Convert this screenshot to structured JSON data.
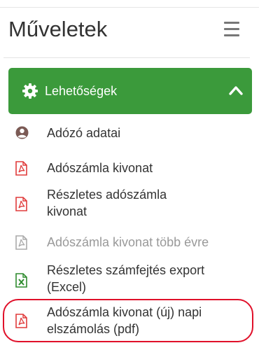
{
  "header": {
    "title": "Műveletek",
    "menu_icon": "hamburger-icon"
  },
  "panel": {
    "label": "Lehetőségek",
    "icon": "gear-icon",
    "toggle_icon": "chevron-up-icon",
    "color": "#3b9a3b"
  },
  "items": [
    {
      "label": "Adózó adatai",
      "icon": "user-circle-icon"
    },
    {
      "label": "Adószámla kivonat",
      "icon": "pdf-file-icon"
    },
    {
      "line1": "Részletes adószámla",
      "line2": "kivonat",
      "icon": "pdf-file-icon"
    },
    {
      "label": "Adószámla kivonat több évre",
      "icon": "pdf-file-icon",
      "disabled": true
    },
    {
      "line1": "Részletes számfejtés export",
      "line2": "(Excel)",
      "icon": "excel-file-icon"
    },
    {
      "line1": "Adószámla kivonat (új) napi",
      "line2": "elszámolás (pdf)",
      "icon": "pdf-file-icon",
      "highlighted": true
    }
  ],
  "colors": {
    "pdf": "#e03b3b",
    "excel": "#2e8b2e",
    "disabled": "#aaaaaa",
    "highlight": "#e0102a"
  }
}
